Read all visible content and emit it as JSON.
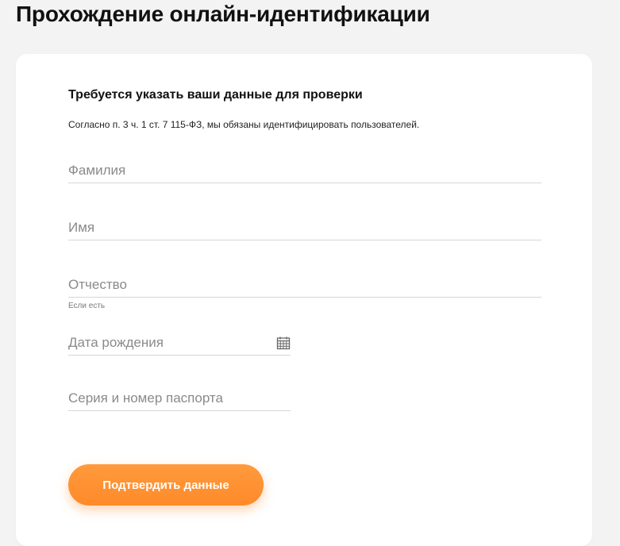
{
  "page": {
    "title": "Прохождение онлайн-идентификации"
  },
  "form": {
    "heading": "Требуется указать ваши данные для проверки",
    "note": "Согласно п. 3 ч. 1 ст. 7 115-ФЗ, мы обязаны идентифицировать пользователей.",
    "fields": {
      "last_name": {
        "placeholder": "Фамилия",
        "value": ""
      },
      "first_name": {
        "placeholder": "Имя",
        "value": ""
      },
      "patronymic": {
        "placeholder": "Отчество",
        "value": "",
        "hint": "Если есть"
      },
      "birth_date": {
        "placeholder": "Дата рождения",
        "value": "",
        "icon": "calendar-icon"
      },
      "passport": {
        "placeholder": "Серия и номер паспорта",
        "value": ""
      }
    },
    "submit_label": "Подтвердить данные"
  },
  "colors": {
    "background": "#f3f3f3",
    "card": "#ffffff",
    "accent": "#ff8a2a",
    "field_border": "#d6d6d6",
    "placeholder": "#8a8a8a"
  }
}
